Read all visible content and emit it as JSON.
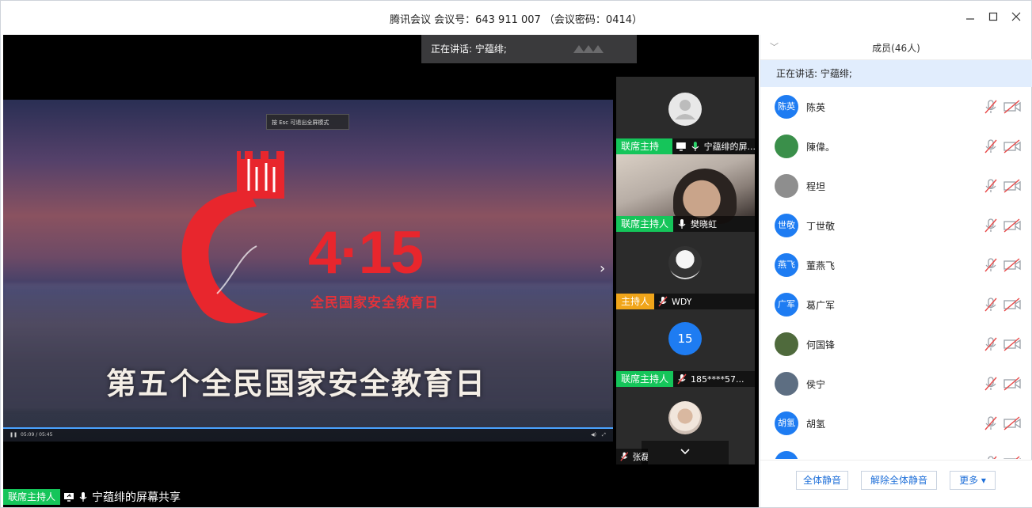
{
  "window": {
    "title": "腾讯会议 会议号：643 911 007 （会议密码：0414）"
  },
  "main": {
    "speaking_banner": "正在讲话: 宁蕴绯;",
    "video": {
      "esc_tip": "按 Esc 可退出全屏模式",
      "big_number": "4·15",
      "subtitle_red": "全民国家安全教育日",
      "caption": "第五个全民国家安全教育日",
      "time": "05:09 / 05:45"
    },
    "bottom_role": "联席主持人",
    "bottom_label": "宁蕴绯的屏幕共享"
  },
  "tiles": [
    {
      "role": "联席主持人",
      "name": "宁蕴绯的屏...",
      "type": "placeholder"
    },
    {
      "role": "联席主持人",
      "name": "樊晓虹",
      "type": "camera"
    },
    {
      "role": "主持人",
      "name": "WDY",
      "type": "photo"
    },
    {
      "role": "联席主持人",
      "name": "185****57...",
      "type": "number",
      "avatar_text": "15"
    },
    {
      "role": "",
      "name": "张磊",
      "type": "photo"
    }
  ],
  "sidebar": {
    "title": "成员(46人)",
    "speaking": "正在讲话: 宁蕴绯;",
    "members": [
      {
        "avatar": "陈英",
        "name": "陈英",
        "avatar_color": "#1e7cf2"
      },
      {
        "avatar": "",
        "name": "陳偉。",
        "avatar_color": "#3a8f4a"
      },
      {
        "avatar": "",
        "name": "程坦",
        "avatar_color": "#8e8e8e"
      },
      {
        "avatar": "世敬",
        "name": "丁世敬",
        "avatar_color": "#1e7cf2"
      },
      {
        "avatar": "燕飞",
        "name": "董燕飞",
        "avatar_color": "#1e7cf2"
      },
      {
        "avatar": "广军",
        "name": "葛广军",
        "avatar_color": "#1e7cf2"
      },
      {
        "avatar": "",
        "name": "何国锋",
        "avatar_color": "#4f6a3c"
      },
      {
        "avatar": "",
        "name": "侯宁",
        "avatar_color": "#5d6e82"
      },
      {
        "avatar": "胡氢",
        "name": "胡氢",
        "avatar_color": "#1e7cf2"
      },
      {
        "avatar": "",
        "name": "",
        "avatar_color": "#1e7cf2"
      }
    ],
    "buttons": {
      "mute_all": "全体静音",
      "unmute_all": "解除全体静音",
      "more": "更多 ▾"
    }
  },
  "colors": {
    "co_host_tag": "#15c55a",
    "host_tag": "#f0a51a",
    "accent_blue": "#1e7cf2"
  }
}
